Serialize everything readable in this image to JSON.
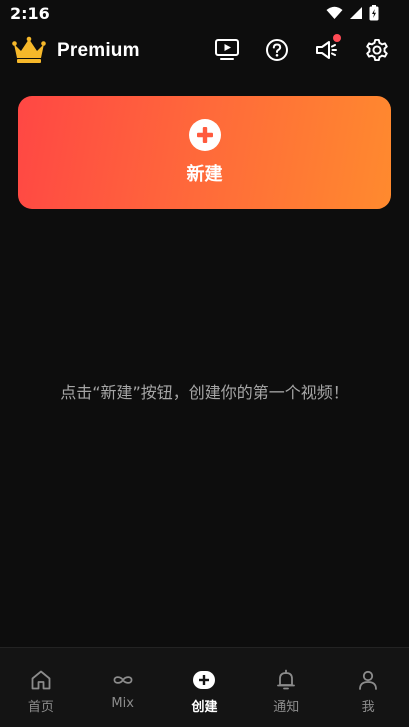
{
  "status_bar": {
    "time": "2:16"
  },
  "header": {
    "brand": "Premium"
  },
  "create_card": {
    "label": "新建"
  },
  "empty_state": {
    "text": "点击“新建”按钮，创建你的第一个视频！"
  },
  "bottom_nav": {
    "items": [
      {
        "label": "首页",
        "icon": "home-icon"
      },
      {
        "label": "Mix",
        "icon": "infinity-icon"
      },
      {
        "label": "创建",
        "icon": "plus-circle-icon"
      },
      {
        "label": "通知",
        "icon": "bell-icon"
      },
      {
        "label": "我",
        "icon": "person-icon"
      }
    ],
    "active_index": 2
  },
  "colors": {
    "background": "#0d0d0d",
    "card_gradient_start": "#ff4744",
    "card_gradient_end": "#ff8a2e",
    "crown": "#f6b82a",
    "notification_dot": "#ff4b55"
  }
}
